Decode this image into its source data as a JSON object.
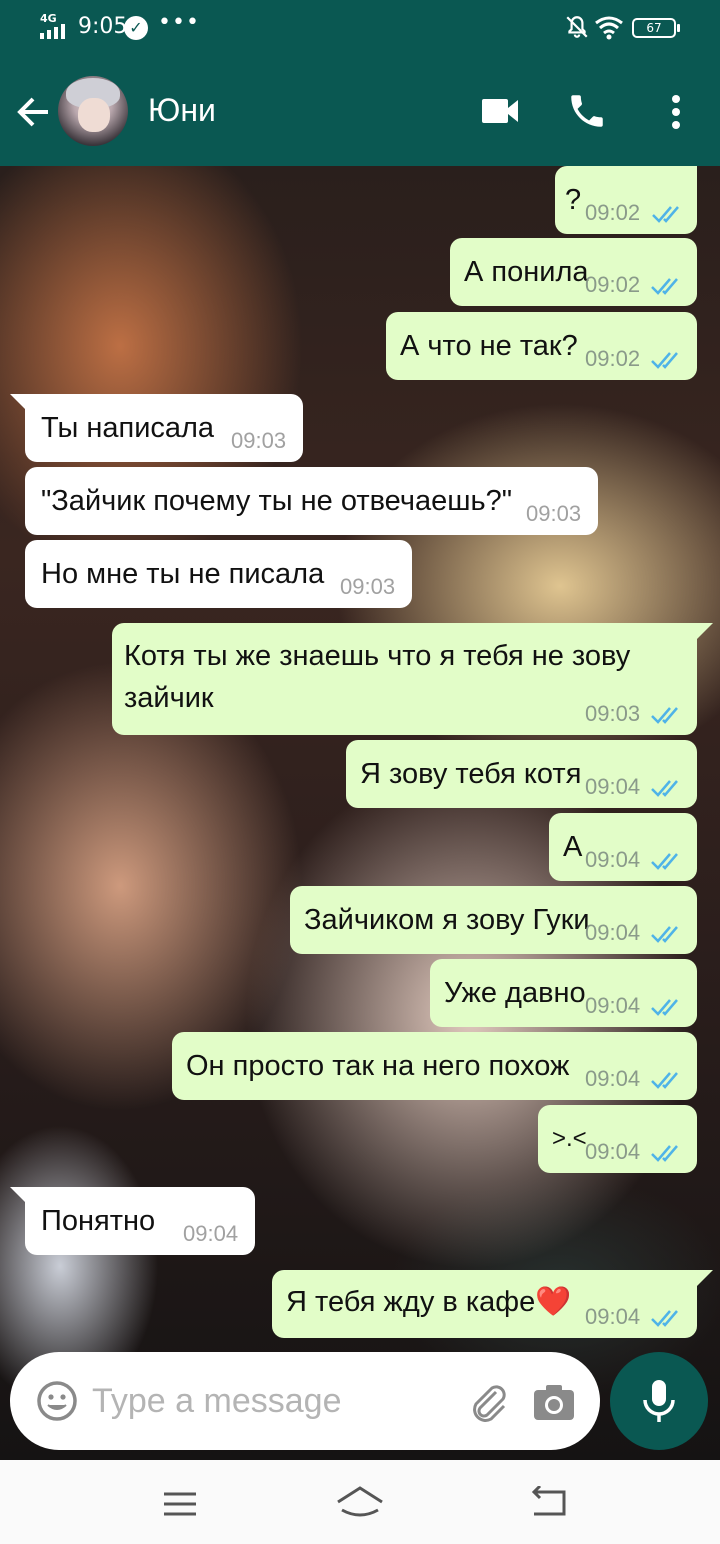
{
  "status_bar": {
    "network": "4G",
    "time": "9:05",
    "more": "•••",
    "battery": "67"
  },
  "header": {
    "contact_name": "Юни"
  },
  "messages": [
    {
      "dir": "out",
      "text": "?",
      "time": "09:02"
    },
    {
      "dir": "out",
      "text": "А понила",
      "time": "09:02"
    },
    {
      "dir": "out",
      "text": "А что не так?",
      "time": "09:02"
    },
    {
      "dir": "in",
      "text": "Ты написала",
      "time": "09:03"
    },
    {
      "dir": "in",
      "text": "\"Зайчик почему ты не отвечаешь?\"",
      "time": "09:03"
    },
    {
      "dir": "in",
      "text": "Но мне ты не писала",
      "time": "09:03"
    },
    {
      "dir": "out",
      "text": "Котя ты же знаешь что я тебя не зову зайчик",
      "time": "09:03"
    },
    {
      "dir": "out",
      "text": "Я зову тебя котя",
      "time": "09:04"
    },
    {
      "dir": "out",
      "text": "А",
      "time": "09:04"
    },
    {
      "dir": "out",
      "text": "Зайчиком я зову Гуки",
      "time": "09:04"
    },
    {
      "dir": "out",
      "text": "Уже давно",
      "time": "09:04"
    },
    {
      "dir": "out",
      "text": "Он просто так на него похож",
      "time": "09:04"
    },
    {
      "dir": "out",
      "text": ">.<",
      "time": "09:04"
    },
    {
      "dir": "in",
      "text": "Понятно",
      "time": "09:04"
    },
    {
      "dir": "out",
      "text": "Я тебя жду в кафе❤️",
      "time": "09:04"
    }
  ],
  "input": {
    "placeholder": "Type a message"
  },
  "colors": {
    "header": "#0a5852",
    "outgoing_bubble": "#e2fdc8",
    "incoming_bubble": "#ffffff",
    "read_ticks": "#4fb3e8"
  },
  "icons": [
    "back-arrow-icon",
    "video-call-icon",
    "phone-icon",
    "more-vert-icon",
    "emoji-icon",
    "attach-icon",
    "camera-icon",
    "mic-icon"
  ]
}
